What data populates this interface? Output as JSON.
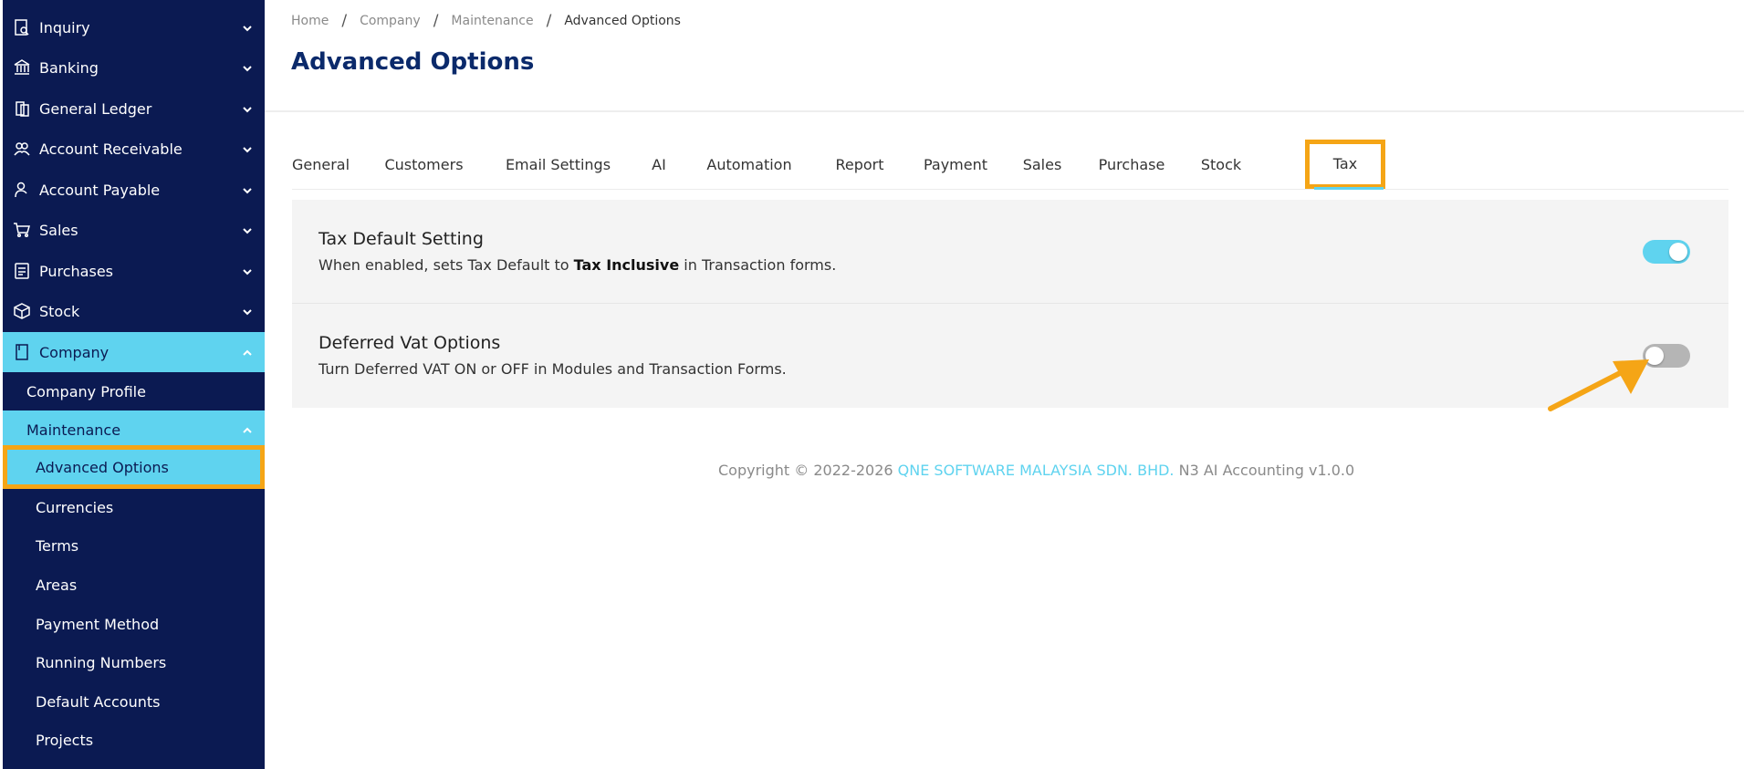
{
  "sidebar": {
    "items": [
      {
        "label": "Inquiry",
        "icon": "inquiry-icon"
      },
      {
        "label": "Banking",
        "icon": "bank-icon"
      },
      {
        "label": "General Ledger",
        "icon": "ledger-icon"
      },
      {
        "label": "Account Receivable",
        "icon": "receivable-icon"
      },
      {
        "label": "Account Payable",
        "icon": "payable-icon"
      },
      {
        "label": "Sales",
        "icon": "cart-icon"
      },
      {
        "label": "Purchases",
        "icon": "purchases-icon"
      },
      {
        "label": "Stock",
        "icon": "box-icon"
      },
      {
        "label": "Company",
        "icon": "building-icon"
      }
    ],
    "company_sub": {
      "profile": "Company Profile",
      "maintenance": "Maintenance"
    },
    "maintenance_sub": [
      "Advanced Options",
      "Currencies",
      "Terms",
      "Areas",
      "Payment Method",
      "Running Numbers",
      "Default Accounts",
      "Projects"
    ]
  },
  "breadcrumb": {
    "home": "Home",
    "company": "Company",
    "maintenance": "Maintenance",
    "current": "Advanced Options",
    "separator": "/"
  },
  "page": {
    "title": "Advanced Options"
  },
  "tabs": [
    "General",
    "Customers",
    "Email Settings",
    "AI",
    "Automation",
    "Report",
    "Payment",
    "Sales",
    "Purchase",
    "Stock",
    "Tax"
  ],
  "active_tab": "Tax",
  "settings": {
    "tax_default": {
      "title": "Tax Default Setting",
      "desc_before": "When enabled, sets Tax Default to ",
      "desc_bold": "Tax Inclusive",
      "desc_after": " in Transaction forms.",
      "enabled": true
    },
    "deferred_vat": {
      "title": "Deferred Vat Options",
      "desc": "Turn Deferred VAT ON or OFF in Modules and Transaction Forms.",
      "enabled": false
    }
  },
  "footer": {
    "prefix": "Copyright © 2022-2026 ",
    "company": "QNE SOFTWARE MALAYSIA SDN. BHD.",
    "suffix": " N3 AI Accounting v1.0.0"
  },
  "colors": {
    "sidebar_bg": "#0b1a52",
    "accent": "#5fd3ef",
    "highlight": "#f5a516",
    "title": "#0b2a6b"
  }
}
